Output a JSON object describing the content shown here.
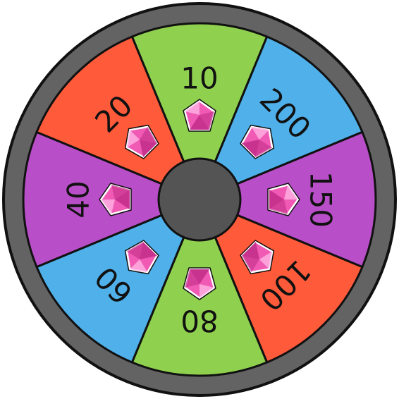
{
  "wheel": {
    "rim_color": "#636363",
    "hub_color": "#545454",
    "outline_color": "#111111",
    "gem": {
      "icon": "pink-gem-icon",
      "fill": "#f05ab4",
      "shade": "#c8338f",
      "highlight": "#ffb3e3"
    },
    "segments": [
      {
        "label": "10",
        "color": "#8fd14f"
      },
      {
        "label": "200",
        "color": "#4fb0ea"
      },
      {
        "label": "150",
        "color": "#b94fc8"
      },
      {
        "label": "100",
        "color": "#ff5a3a"
      },
      {
        "label": "80",
        "color": "#8fd14f"
      },
      {
        "label": "60",
        "color": "#4fb0ea"
      },
      {
        "label": "40",
        "color": "#b94fc8"
      },
      {
        "label": "20",
        "color": "#ff5a3a"
      }
    ]
  }
}
